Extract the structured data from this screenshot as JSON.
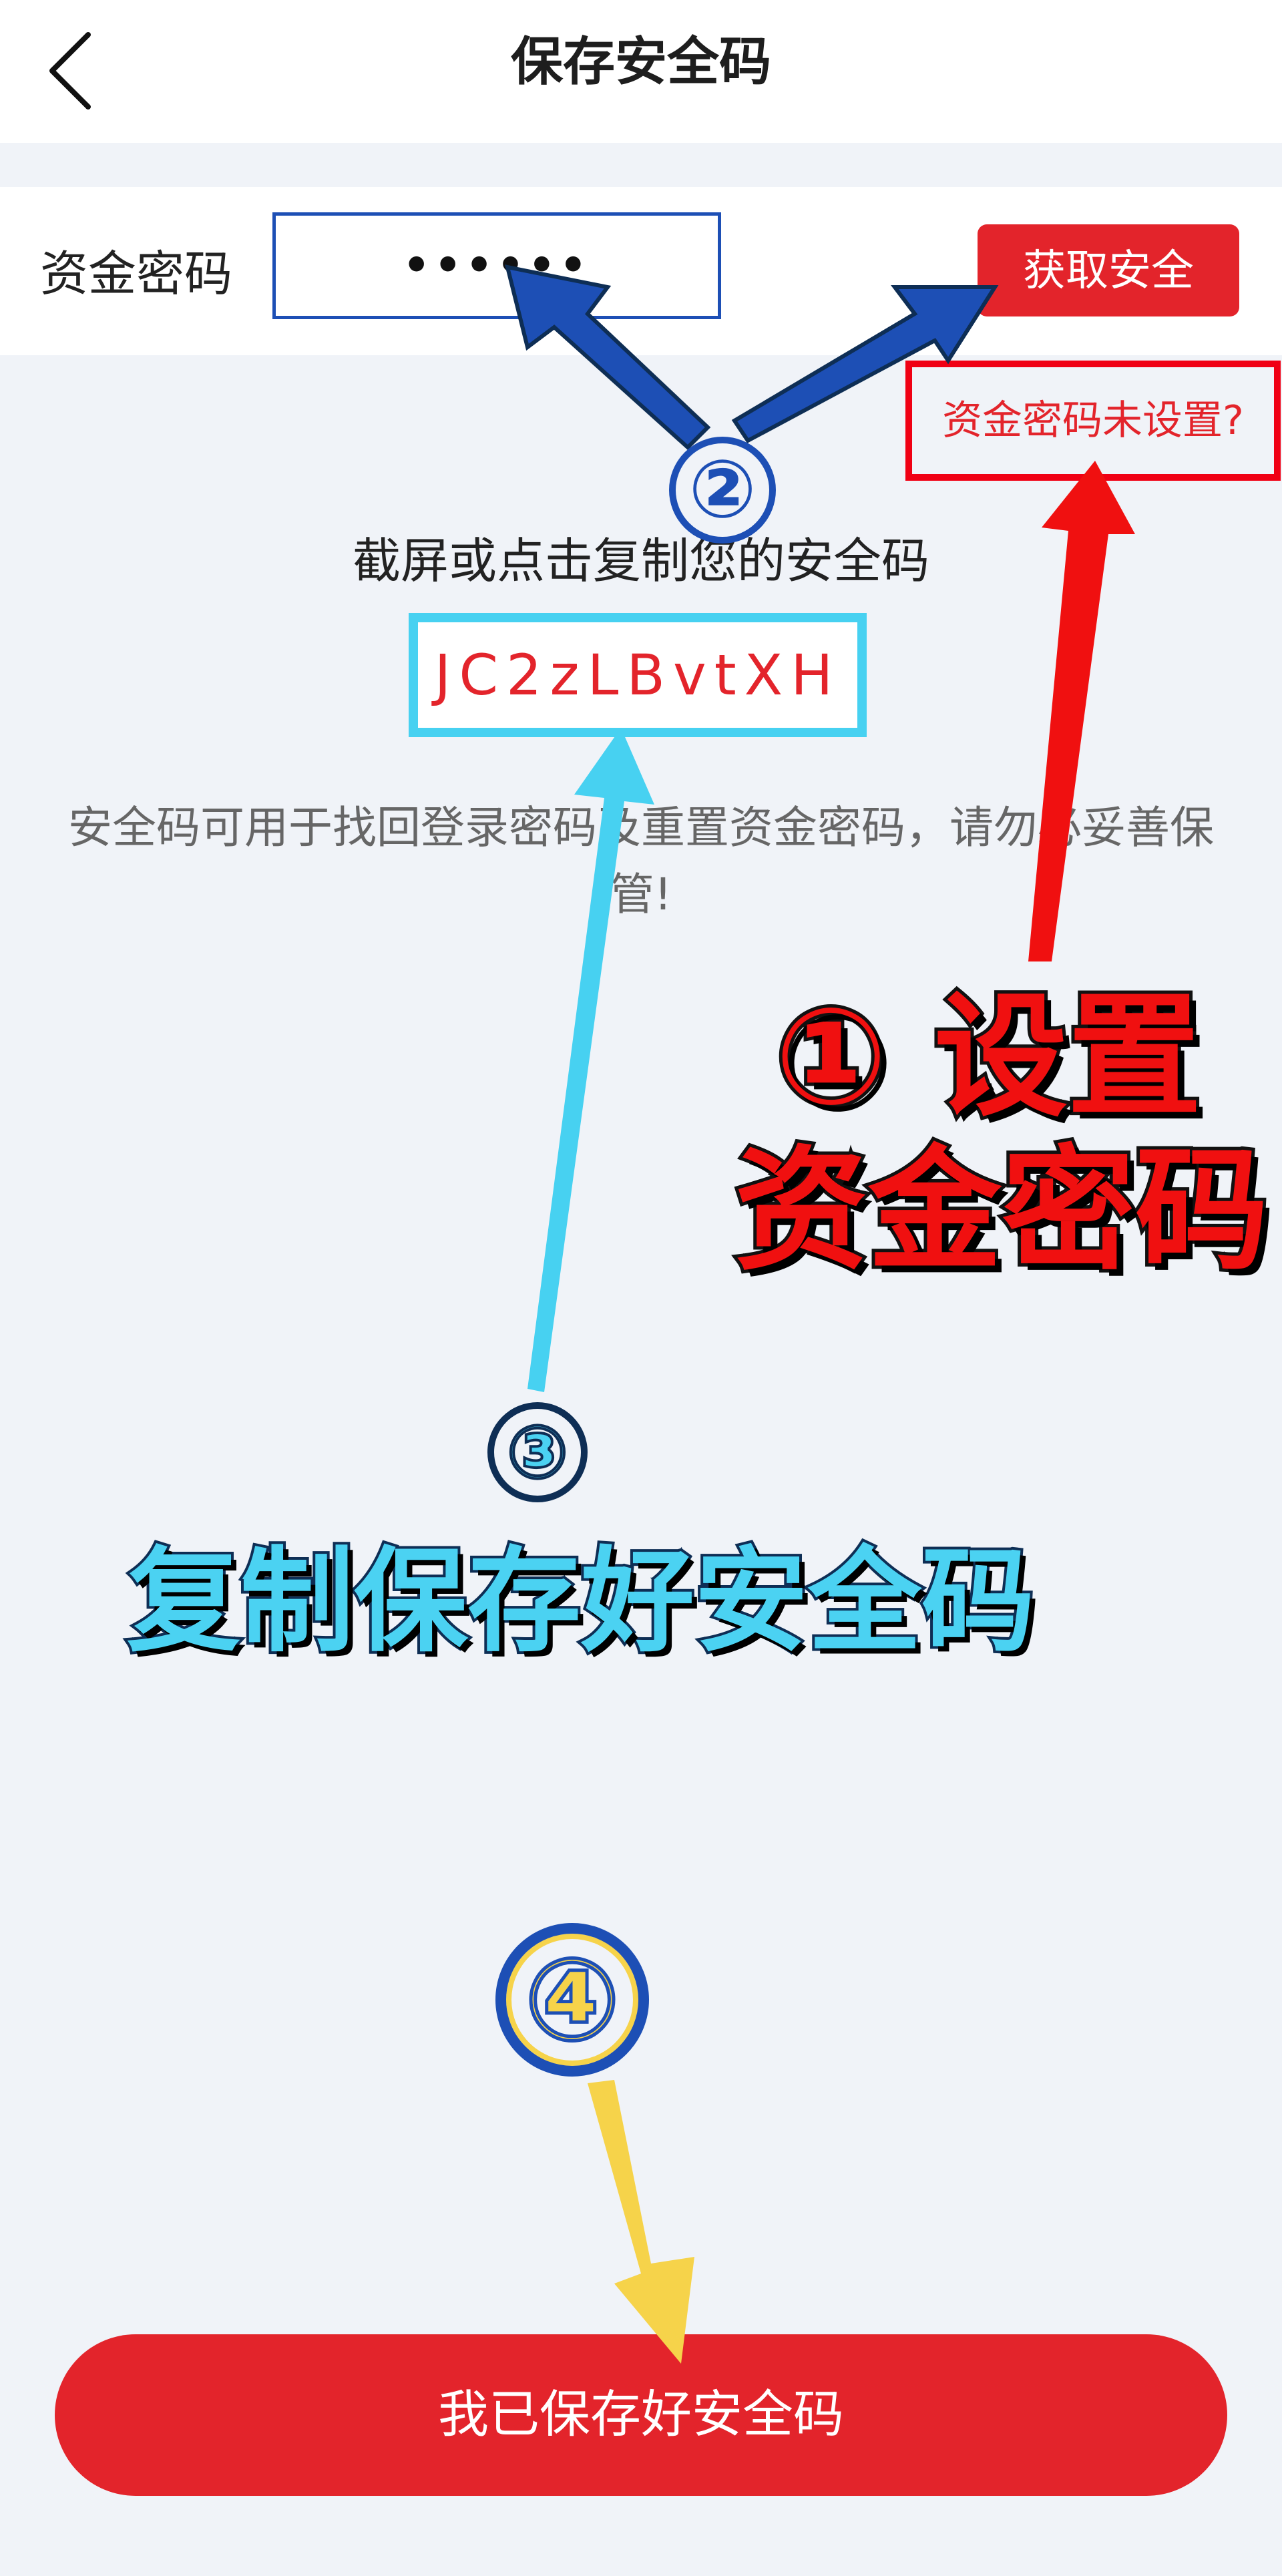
{
  "header": {
    "title": "保存安全码",
    "back_icon": "chevron-left-icon"
  },
  "form": {
    "label": "资金密码",
    "password_value": "••••••",
    "get_button_label": "获取安全",
    "not_set_link": "资金密码未设置?"
  },
  "code": {
    "hint": "截屏或点击复制您的安全码",
    "value": "JC2zLBvtXH",
    "note": "安全码可用于找回登录密码及重置资金密码，请勿必妥善保管!"
  },
  "footer": {
    "save_button_label": "我已保存好安全码"
  },
  "annotations": {
    "step1_line1": "① 设置",
    "step1_line2": "资金密码",
    "step2_badge": "②",
    "step3_badge": "③",
    "step3_text": "复制保存好安全码",
    "step4_badge": "④"
  },
  "colors": {
    "accent_red": "#e3242b",
    "input_border_blue": "#1d4fb5",
    "code_border_cyan": "#47d1f1",
    "arrow_yellow": "#f6d34a"
  }
}
